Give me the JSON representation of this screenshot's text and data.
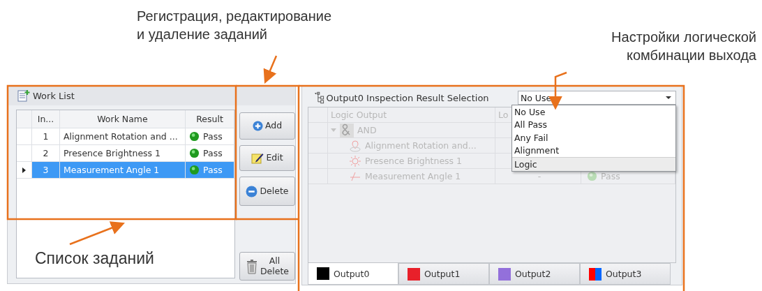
{
  "annotations": [
    {
      "kind": "top",
      "lines": [
        "Регистрация, редактирование",
        "и удаление заданий"
      ]
    },
    {
      "kind": "right",
      "lines": [
        "Настройки логической",
        "комбинации выхода"
      ]
    },
    {
      "kind": "bottom",
      "lines": [
        "Список заданий"
      ]
    }
  ],
  "work_list": {
    "title": "Work List",
    "columns": [
      "In...",
      "Work Name",
      "Result"
    ],
    "rows": [
      {
        "index": "1",
        "name": "Alignment Rotation and ...",
        "result": "Pass",
        "selected": false
      },
      {
        "index": "2",
        "name": "Presence Brightness 1",
        "result": "Pass",
        "selected": false
      },
      {
        "index": "3",
        "name": "Measurement Angle 1",
        "result": "Pass",
        "selected": true
      }
    ]
  },
  "buttons": [
    {
      "kind": "add",
      "label": "Add"
    },
    {
      "kind": "edit",
      "label": "Edit"
    },
    {
      "kind": "delete",
      "label": "Delete"
    },
    {
      "kind": "all_delete",
      "label": "All\nDelete"
    }
  ],
  "output_panel": {
    "label": "Output0 Inspection Result Selection",
    "dropdown": {
      "value": "No Use",
      "options": [
        {
          "label": "No Use",
          "highlighted": false
        },
        {
          "label": "All Pass",
          "highlighted": false
        },
        {
          "label": "Any Fail",
          "highlighted": false
        },
        {
          "label": "Alignment",
          "highlighted": false
        },
        {
          "label": "Logic",
          "highlighted": true
        }
      ]
    },
    "columns": [
      "Logic Output",
      "Lo"
    ],
    "tree": {
      "name": "AND",
      "expanded": true,
      "children": [
        {
          "kind": "alignment",
          "name": "Alignment Rotation and..."
        },
        {
          "kind": "presence",
          "name": "Presence Brightness 1"
        },
        {
          "kind": "measurement",
          "name": "Measurement Angle 1",
          "column_2": "-",
          "result": "Pass"
        }
      ]
    },
    "tabs": [
      {
        "label": "Output0",
        "swatches": [
          {
            "color": "#000000"
          }
        ],
        "selected": true
      },
      {
        "label": "Output1",
        "swatches": [
          {
            "color": "#e8202a"
          }
        ],
        "selected": false
      },
      {
        "label": "Output2",
        "swatches": [
          {
            "color": "#9370db"
          }
        ],
        "selected": false
      },
      {
        "label": "Output3",
        "swatches": [
          {
            "color": "#ff0000"
          },
          {
            "color": "#0066ff"
          }
        ],
        "selected": false
      }
    ]
  }
}
